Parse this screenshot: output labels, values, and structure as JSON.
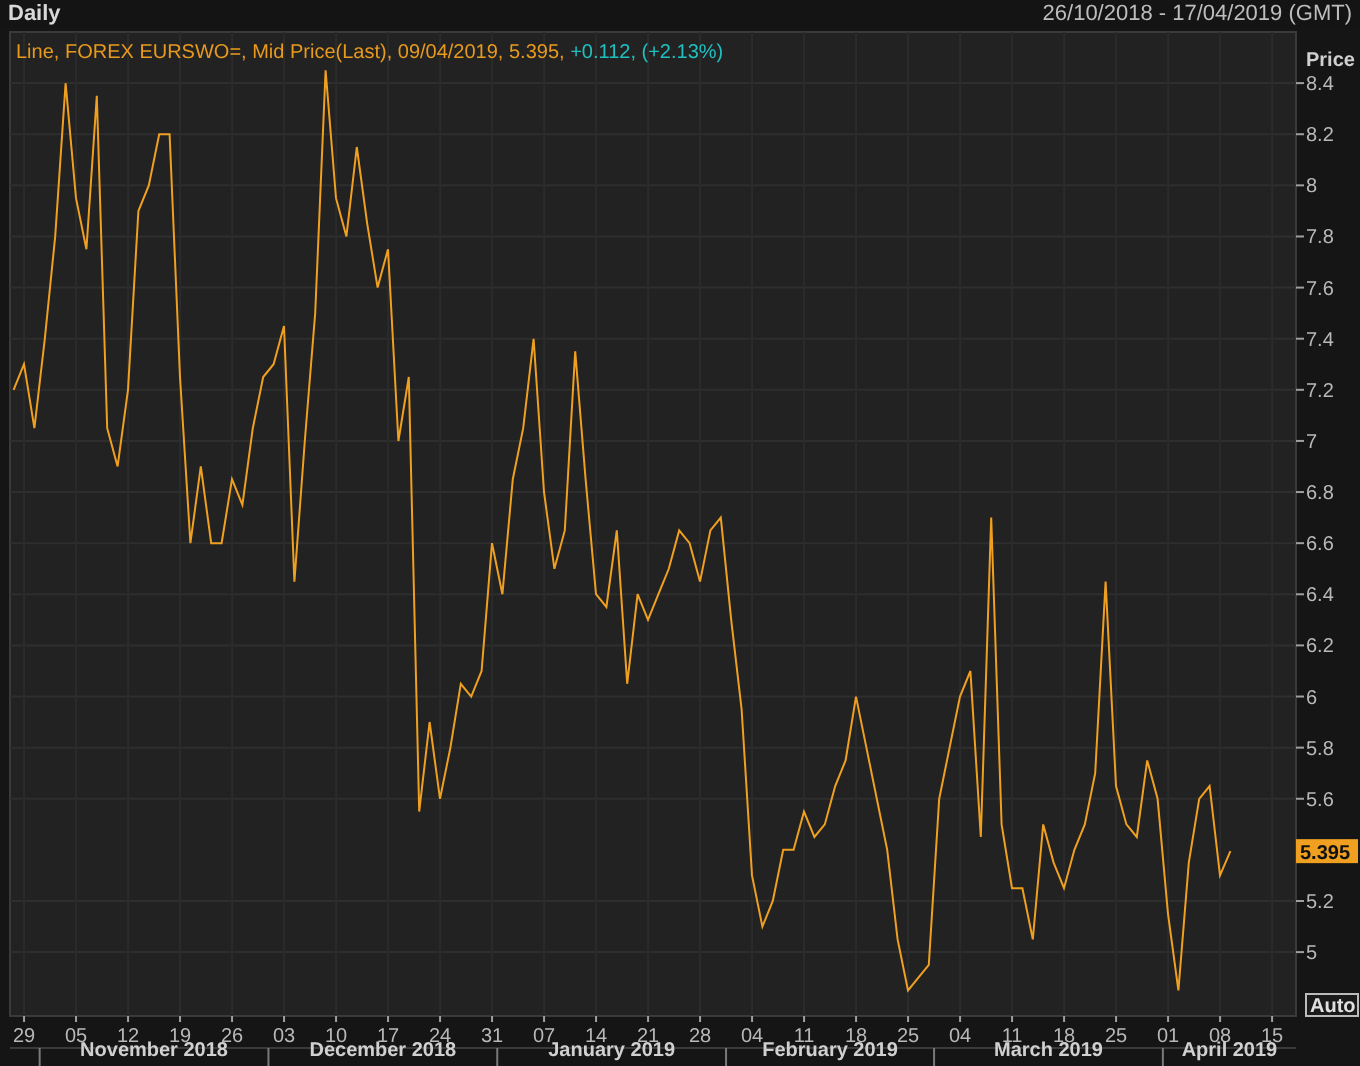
{
  "header": {
    "title": "Daily",
    "range": "26/10/2018 - 17/04/2019 (GMT)"
  },
  "legend": {
    "prefix": "Line, ",
    "details": ", 09/04/2019, 5.395, ",
    "change": "+0.112, (+2.13%)"
  },
  "auto_button": "Auto",
  "chart_data": {
    "type": "line",
    "ylabel": "Price",
    "ylim": [
      4.75,
      8.6
    ],
    "categories": [
      null,
      "29",
      null,
      null,
      null,
      null,
      "05",
      null,
      null,
      null,
      null,
      "12",
      null,
      null,
      null,
      null,
      "19",
      null,
      null,
      null,
      null,
      "26",
      null,
      null,
      null,
      null,
      "03",
      null,
      null,
      null,
      null,
      "10",
      null,
      null,
      null,
      null,
      "17",
      null,
      null,
      null,
      null,
      "24",
      null,
      null,
      null,
      null,
      "31",
      null,
      null,
      null,
      null,
      "07",
      null,
      null,
      null,
      null,
      "14",
      null,
      null,
      null,
      null,
      "21",
      null,
      null,
      null,
      null,
      "28",
      null,
      null,
      null,
      null,
      "04",
      null,
      null,
      null,
      null,
      "11",
      null,
      null,
      null,
      null,
      "18",
      null,
      null,
      null,
      null,
      "25",
      null,
      null,
      null,
      null,
      "04",
      null,
      null,
      null,
      null,
      "11",
      null,
      null,
      null,
      null,
      "18",
      null,
      null,
      null,
      null,
      "25",
      null,
      null,
      null,
      null,
      "01",
      null,
      null,
      null,
      null,
      "08",
      null,
      null,
      null,
      null,
      "15",
      null,
      null
    ],
    "series": [
      {
        "name": "FOREX EURSWO=, Mid Price(Last)",
        "color": "#f0a020",
        "values": [
          7.2,
          7.3,
          7.05,
          7.4,
          7.8,
          8.4,
          7.95,
          7.75,
          8.35,
          7.05,
          6.9,
          7.2,
          7.9,
          8.0,
          8.2,
          8.2,
          7.25,
          6.6,
          6.9,
          6.6,
          6.6,
          6.85,
          6.75,
          7.05,
          7.25,
          7.3,
          7.45,
          6.45,
          7.0,
          7.5,
          8.45,
          7.95,
          7.8,
          8.15,
          7.85,
          7.6,
          7.75,
          7.0,
          7.25,
          5.55,
          5.9,
          5.6,
          5.8,
          6.05,
          6.0,
          6.1,
          6.6,
          6.4,
          6.85,
          7.05,
          7.4,
          6.8,
          6.5,
          6.65,
          7.35,
          6.85,
          6.4,
          6.35,
          6.65,
          6.05,
          6.4,
          6.3,
          6.4,
          6.5,
          6.65,
          6.6,
          6.45,
          6.65,
          6.7,
          6.3,
          5.95,
          5.3,
          5.1,
          5.2,
          5.4,
          5.4,
          5.55,
          5.45,
          5.5,
          5.65,
          5.75,
          6.0,
          5.8,
          5.6,
          5.4,
          5.05,
          4.85,
          4.9,
          4.95,
          5.6,
          5.8,
          6.0,
          6.1,
          5.45,
          6.7,
          5.5,
          5.25,
          5.25,
          5.05,
          5.5,
          5.35,
          5.25,
          5.4,
          5.5,
          5.7,
          6.45,
          5.65,
          5.5,
          5.45,
          5.75,
          5.6,
          5.15,
          4.85,
          5.35,
          5.6,
          5.65,
          5.3,
          5.395,
          null,
          null,
          null,
          null,
          null,
          null
        ]
      }
    ],
    "yticks": [
      5,
      5.2,
      5.6,
      5.8,
      6,
      6.2,
      6.4,
      6.6,
      6.8,
      7,
      7.2,
      7.4,
      7.6,
      7.8,
      8,
      8.2,
      8.4
    ],
    "grid": true
  },
  "last_price_tag": "5.395",
  "months": [
    "November 2018",
    "December 2018",
    "January 2019",
    "February 2019",
    "March 2019",
    "April 2019"
  ]
}
